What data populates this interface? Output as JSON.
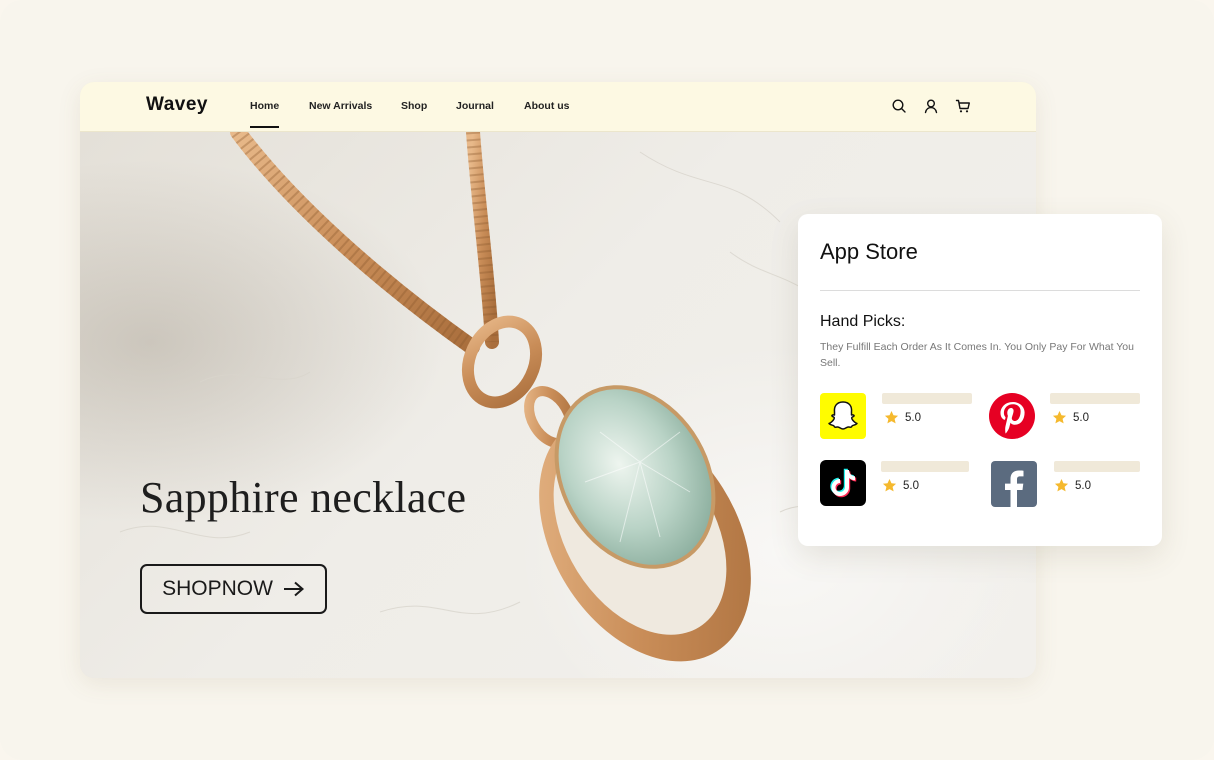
{
  "nav": {
    "logo": "Wavey",
    "links": [
      {
        "label": "Home",
        "active": true
      },
      {
        "label": "New Arrivals"
      },
      {
        "label": "Shop"
      },
      {
        "label": "Journal"
      },
      {
        "label": "About us"
      }
    ],
    "icons": [
      "search-icon",
      "user-icon",
      "cart-icon"
    ]
  },
  "hero": {
    "title": "Sapphire necklace",
    "cta_label": "SHOPNOW"
  },
  "card": {
    "title": "App Store",
    "subtitle": "Hand Picks:",
    "description": "They Fulfill Each Order As It Comes In. You Only Pay For What You Sell.",
    "apps": [
      {
        "name": "snapchat-icon",
        "rating": "5.0",
        "color": "#fffc00"
      },
      {
        "name": "pinterest-icon",
        "rating": "5.0",
        "color": "#e60023"
      },
      {
        "name": "tiktok-icon",
        "rating": "5.0",
        "color": "#000000"
      },
      {
        "name": "facebook-icon",
        "rating": "5.0",
        "color": "#5b6b7f"
      }
    ]
  },
  "colors": {
    "navbar_bg": "#fdf9e3",
    "page_bg": "#f8f5ed",
    "star": "#f5b92e",
    "gold": "#c9935a"
  }
}
